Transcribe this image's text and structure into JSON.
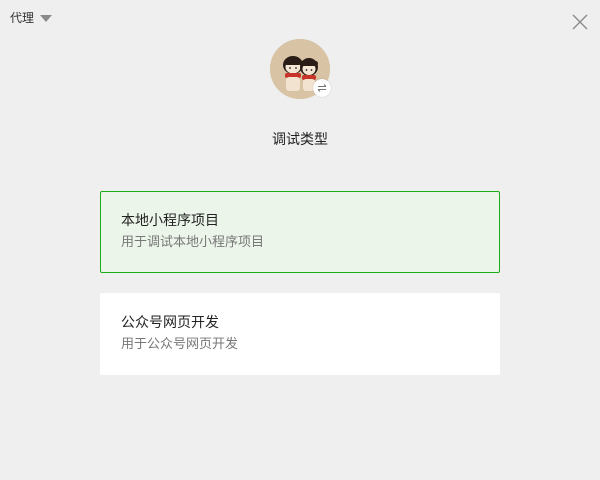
{
  "topbar": {
    "proxy_label": "代理",
    "proxy_caret_icon": "caret-down-icon",
    "close_icon": "close-icon"
  },
  "profile": {
    "avatar_icon": "user-avatar",
    "switch_icon": "swap-arrows-icon"
  },
  "title": "调试类型",
  "options": [
    {
      "title": "本地小程序项目",
      "description": "用于调试本地小程序项目",
      "selected": true
    },
    {
      "title": "公众号网页开发",
      "description": "用于公众号网页开发",
      "selected": false
    }
  ],
  "colors": {
    "background": "#efefef",
    "card_background": "#ffffff",
    "selected_background": "#ecf5ea",
    "selected_border": "#1aad19"
  }
}
